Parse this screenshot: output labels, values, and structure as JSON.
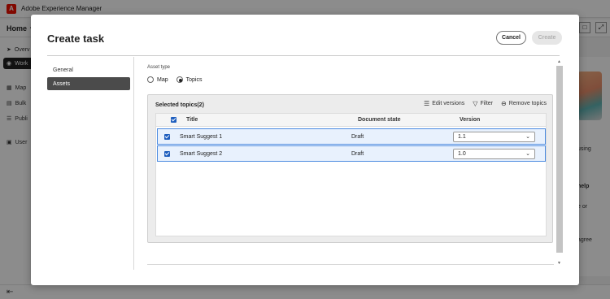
{
  "app": {
    "title": "Adobe Experience Manager",
    "logo_letter": "A",
    "home_label": "Home",
    "nav": [
      {
        "label": "Overv",
        "icon": "send-icon"
      },
      {
        "label": "Work",
        "icon": "pin-icon"
      },
      {
        "label": "Map",
        "icon": "map-icon"
      },
      {
        "label": "Bulk",
        "icon": "folder-icon"
      },
      {
        "label": "Publi",
        "icon": "list-icon"
      },
      {
        "label": "User",
        "icon": "user-icon"
      }
    ],
    "right_fragments": [
      "using",
      "help",
      "e or",
      "agree"
    ]
  },
  "dialog": {
    "title": "Create task",
    "cancel_label": "Cancel",
    "create_label": "Create",
    "side": [
      {
        "label": "General",
        "active": false
      },
      {
        "label": "Assets",
        "active": true
      }
    ],
    "asset_type_label": "Asset type",
    "radio_options": [
      {
        "label": "Map",
        "checked": false
      },
      {
        "label": "Topics",
        "checked": true
      }
    ],
    "panel": {
      "title": "Selected topics(2)",
      "actions": [
        {
          "label": "Edit versions",
          "icon": "database-icon"
        },
        {
          "label": "Filter",
          "icon": "filter-icon"
        },
        {
          "label": "Remove topics",
          "icon": "remove-circle-icon"
        }
      ]
    },
    "table": {
      "columns": [
        "Title",
        "Document state",
        "Version"
      ],
      "rows": [
        {
          "title": "Smart Suggest 1",
          "state": "Draft",
          "version": "1.1",
          "checked": true
        },
        {
          "title": "Smart Suggest 2",
          "state": "Draft",
          "version": "1.0",
          "checked": true
        }
      ]
    }
  },
  "colors": {
    "accent": "#1e5ebe",
    "brand": "#eb1000",
    "row_highlight": "#e8f1fd"
  }
}
